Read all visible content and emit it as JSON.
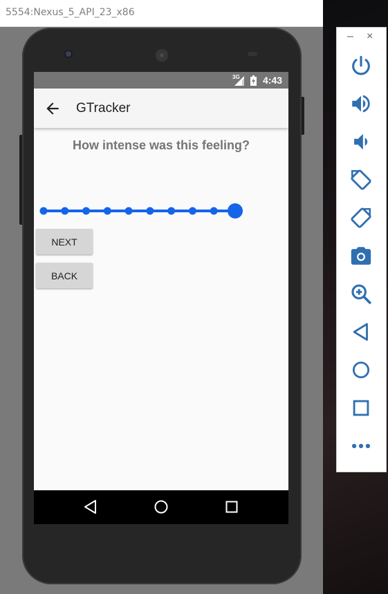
{
  "window": {
    "title": "5554:Nexus_5_API_23_x86"
  },
  "status_bar": {
    "network": "3G",
    "time": "4:43"
  },
  "app_bar": {
    "title": "GTracker",
    "back_icon": "arrow-back-icon"
  },
  "content": {
    "question": "How intense was this feeling?",
    "slider": {
      "min": 0,
      "max": 9,
      "value": 9,
      "accent_color": "#1565e8"
    },
    "buttons": {
      "next": "NEXT",
      "back": "BACK"
    }
  },
  "nav_bar": {
    "icons": [
      "back-triangle-icon",
      "home-circle-icon",
      "recents-square-icon"
    ]
  },
  "emulator_toolbar": {
    "minimize": "–",
    "close": "×",
    "icons": [
      "power-icon",
      "volume-up-icon",
      "volume-down-icon",
      "rotate-left-icon",
      "rotate-right-icon",
      "camera-icon",
      "zoom-icon",
      "back-icon",
      "home-icon",
      "overview-icon",
      "more-icon"
    ]
  },
  "colors": {
    "accent": "#1565e8",
    "status_bar": "#757575",
    "app_bar": "#f5f5f5",
    "toolbar_icon": "#2f6fb1"
  }
}
